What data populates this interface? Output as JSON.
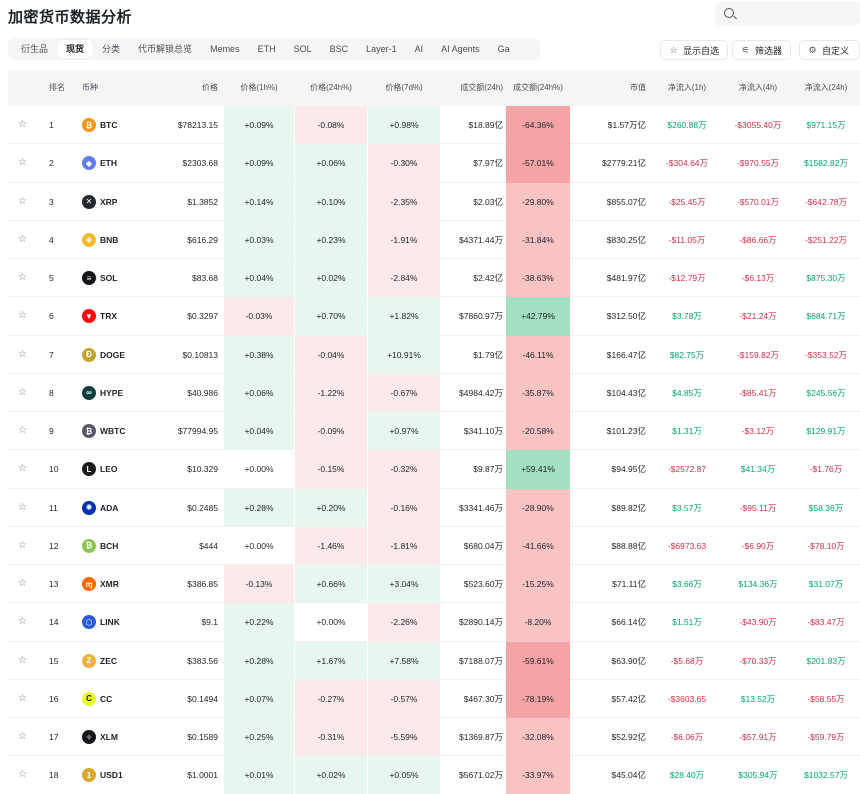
{
  "page": {
    "title": "加密货币数据分析"
  },
  "search": {
    "placeholder": ""
  },
  "tabs": [
    "衍生品",
    "现货",
    "分类",
    "代币解锁总览",
    "Memes",
    "ETH",
    "SOL",
    "BSC",
    "Layer-1",
    "AI",
    "AI Agents",
    "Ga"
  ],
  "active_tab": 1,
  "toolbar": {
    "show_favorites": "显示自选",
    "filter": "筛选器",
    "customize": "自定义"
  },
  "columns": [
    "排名",
    "币种",
    "价格",
    "价格(1h%)",
    "价格(24h%)",
    "价格(7d%)",
    "成交额(24h)",
    "成交额(24h%)",
    "市值",
    "净流入(1h)",
    "净流入(4h)",
    "净流入(24h)"
  ],
  "colors": {
    "positive": "#03a66d",
    "negative": "#cf304a",
    "pos_bg": "#e7f6ee",
    "neg_bg": "#fceaea",
    "strong_pos_bg": "#a3dfc0",
    "strong_neg_bg": "#f4a4a4"
  },
  "coins": [
    {
      "rank": "1",
      "symbol": "BTC",
      "icon": "bitcoin-icon",
      "icon_glyph": "₿",
      "icon_color": "#f7931a",
      "price": "$78213.15",
      "p1h": "+0.09%",
      "p24h": "-0.08%",
      "p7d": "+0.98%",
      "vol": "$18.89亿",
      "vol_pct": "-64.36%",
      "mcap": "$1.57万亿",
      "in1h": "$260.88万",
      "in4h": "-$3055.40万",
      "in24h": "$971.15万"
    },
    {
      "rank": "2",
      "symbol": "ETH",
      "icon": "ethereum-icon",
      "icon_glyph": "◆",
      "icon_color": "#627eea",
      "price": "$2303.68",
      "p1h": "+0.09%",
      "p24h": "+0.06%",
      "p7d": "-0.30%",
      "vol": "$7.97亿",
      "vol_pct": "-57.01%",
      "mcap": "$2779.21亿",
      "in1h": "-$304.64万",
      "in4h": "-$970.55万",
      "in24h": "$1582.82万"
    },
    {
      "rank": "3",
      "symbol": "XRP",
      "icon": "xrp-icon",
      "icon_glyph": "✕",
      "icon_color": "#23292f",
      "price": "$1.3852",
      "p1h": "+0.14%",
      "p24h": "+0.10%",
      "p7d": "-2.35%",
      "vol": "$2.03亿",
      "vol_pct": "-29.80%",
      "mcap": "$855.07亿",
      "in1h": "-$25.45万",
      "in4h": "-$570.01万",
      "in24h": "-$642.78万"
    },
    {
      "rank": "4",
      "symbol": "BNB",
      "icon": "bnb-icon",
      "icon_glyph": "◈",
      "icon_color": "#f3ba2f",
      "price": "$616.29",
      "p1h": "+0.03%",
      "p24h": "+0.23%",
      "p7d": "-1.91%",
      "vol": "$4371.44万",
      "vol_pct": "-31.84%",
      "mcap": "$830.25亿",
      "in1h": "-$11.05万",
      "in4h": "-$86.66万",
      "in24h": "-$251.22万"
    },
    {
      "rank": "5",
      "symbol": "SOL",
      "icon": "solana-icon",
      "icon_glyph": "≡",
      "icon_color": "#14151a",
      "price": "$83.68",
      "p1h": "+0.04%",
      "p24h": "+0.02%",
      "p7d": "-2.84%",
      "vol": "$2.42亿",
      "vol_pct": "-38.63%",
      "mcap": "$481.97亿",
      "in1h": "-$12.79万",
      "in4h": "-$6.13万",
      "in24h": "$875.30万"
    },
    {
      "rank": "6",
      "symbol": "TRX",
      "icon": "tron-icon",
      "icon_glyph": "▼",
      "icon_color": "#ff060a",
      "price": "$0.3297",
      "p1h": "-0.03%",
      "p24h": "+0.70%",
      "p7d": "+1.82%",
      "vol": "$7860.97万",
      "vol_pct": "+42.79%",
      "mcap": "$312.50亿",
      "in1h": "$3.78万",
      "in4h": "-$21.24万",
      "in24h": "$684.71万"
    },
    {
      "rank": "7",
      "symbol": "DOGE",
      "icon": "dogecoin-icon",
      "icon_glyph": "Ð",
      "icon_color": "#c2a633",
      "price": "$0.10813",
      "p1h": "+0.38%",
      "p24h": "-0.04%",
      "p7d": "+10.91%",
      "vol": "$1.79亿",
      "vol_pct": "-46.11%",
      "mcap": "$166.47亿",
      "in1h": "$82.75万",
      "in4h": "-$159.82万",
      "in24h": "-$353.52万"
    },
    {
      "rank": "8",
      "symbol": "HYPE",
      "icon": "hyperliquid-icon",
      "icon_glyph": "∞",
      "icon_color": "#0f3d3e",
      "price": "$40.986",
      "p1h": "+0.06%",
      "p24h": "-1.22%",
      "p7d": "-0.67%",
      "vol": "$4984.42万",
      "vol_pct": "-35.87%",
      "mcap": "$104.43亿",
      "in1h": "$4.85万",
      "in4h": "-$85.41万",
      "in24h": "$245.56万"
    },
    {
      "rank": "9",
      "symbol": "WBTC",
      "icon": "wbtc-icon",
      "icon_glyph": "₿",
      "icon_color": "#5a5564",
      "price": "$77994.95",
      "p1h": "+0.04%",
      "p24h": "-0.09%",
      "p7d": "+0.97%",
      "vol": "$341.10万",
      "vol_pct": "-20.58%",
      "mcap": "$101.23亿",
      "in1h": "$1.31万",
      "in4h": "-$3.12万",
      "in24h": "$129.91万"
    },
    {
      "rank": "10",
      "symbol": "LEO",
      "icon": "leo-icon",
      "icon_glyph": "L",
      "icon_color": "#1b1b1b",
      "price": "$10.329",
      "p1h": "+0.00%",
      "p24h": "-0.15%",
      "p7d": "-0.32%",
      "vol": "$9.87万",
      "vol_pct": "+59.41%",
      "mcap": "$94.95亿",
      "in1h": "-$2572.87",
      "in4h": "$41.34万",
      "in24h": "-$1.76万"
    },
    {
      "rank": "11",
      "symbol": "ADA",
      "icon": "cardano-icon",
      "icon_glyph": "✺",
      "icon_color": "#0033ad",
      "price": "$0.2485",
      "p1h": "+0.28%",
      "p24h": "+0.20%",
      "p7d": "-0.16%",
      "vol": "$3341.46万",
      "vol_pct": "-28.90%",
      "mcap": "$89.82亿",
      "in1h": "$3.57万",
      "in4h": "-$95.11万",
      "in24h": "$58.36万"
    },
    {
      "rank": "12",
      "symbol": "BCH",
      "icon": "bitcoin-cash-icon",
      "icon_glyph": "₿",
      "icon_color": "#8dc351",
      "price": "$444",
      "p1h": "+0.00%",
      "p24h": "-1.46%",
      "p7d": "-1.81%",
      "vol": "$680.04万",
      "vol_pct": "-41.66%",
      "mcap": "$88.88亿",
      "in1h": "-$6973.63",
      "in4h": "-$6.90万",
      "in24h": "-$78.10万"
    },
    {
      "rank": "13",
      "symbol": "XMR",
      "icon": "monero-icon",
      "icon_glyph": "ɱ",
      "icon_color": "#ff6600",
      "price": "$386.85",
      "p1h": "-0.13%",
      "p24h": "+0.66%",
      "p7d": "+3.04%",
      "vol": "$523.60万",
      "vol_pct": "-15.25%",
      "mcap": "$71.11亿",
      "in1h": "$3.66万",
      "in4h": "$134.36万",
      "in24h": "$31.07万"
    },
    {
      "rank": "14",
      "symbol": "LINK",
      "icon": "chainlink-icon",
      "icon_glyph": "⬡",
      "icon_color": "#2a5ada",
      "price": "$9.1",
      "p1h": "+0.22%",
      "p24h": "+0.00%",
      "p7d": "-2.26%",
      "vol": "$2890.14万",
      "vol_pct": "-8.20%",
      "mcap": "$66.14亿",
      "in1h": "$1.51万",
      "in4h": "-$43.90万",
      "in24h": "-$83.47万"
    },
    {
      "rank": "15",
      "symbol": "ZEC",
      "icon": "zcash-icon",
      "icon_glyph": "Z",
      "icon_color": "#ecb244",
      "price": "$383.56",
      "p1h": "+0.28%",
      "p24h": "+1.67%",
      "p7d": "+7.58%",
      "vol": "$7188.07万",
      "vol_pct": "-59.61%",
      "mcap": "$63.90亿",
      "in1h": "-$5.68万",
      "in4h": "-$70.33万",
      "in24h": "$201.83万"
    },
    {
      "rank": "16",
      "symbol": "CC",
      "icon": "canton-coin-icon",
      "icon_glyph": "C",
      "icon_color": "#e8ff2a",
      "price": "$0.1494",
      "p1h": "+0.07%",
      "p24h": "-0.27%",
      "p7d": "-0.57%",
      "vol": "$467.30万",
      "vol_pct": "-78.19%",
      "mcap": "$57.42亿",
      "in1h": "-$3603.65",
      "in4h": "$13.52万",
      "in24h": "-$58.55万"
    },
    {
      "rank": "17",
      "symbol": "XLM",
      "icon": "stellar-icon",
      "icon_glyph": "✧",
      "icon_color": "#14151a",
      "price": "$0.1589",
      "p1h": "+0.25%",
      "p24h": "-0.31%",
      "p7d": "-5.59%",
      "vol": "$1369.87万",
      "vol_pct": "-32.08%",
      "mcap": "$52.92亿",
      "in1h": "-$6.06万",
      "in4h": "-$57.91万",
      "in24h": "-$59.79万"
    },
    {
      "rank": "18",
      "symbol": "USD1",
      "icon": "usd1-icon",
      "icon_glyph": "1",
      "icon_color": "#d9a92b",
      "price": "$1.0001",
      "p1h": "+0.01%",
      "p24h": "+0.02%",
      "p7d": "+0.05%",
      "vol": "$5671.02万",
      "vol_pct": "-33.97%",
      "mcap": "$45.04亿",
      "in1h": "$28.40万",
      "in4h": "$305.94万",
      "in24h": "$1032.57万"
    }
  ]
}
